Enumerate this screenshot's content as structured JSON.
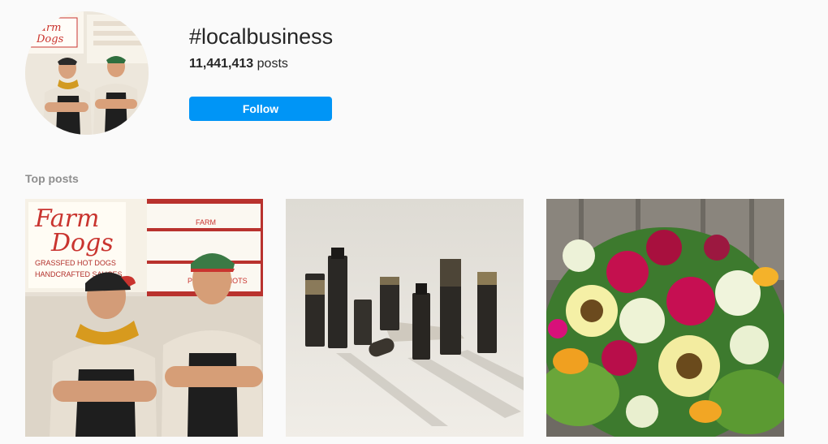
{
  "profile": {
    "avatar_icon": "avatar-photo",
    "hashtag": "#localbusiness",
    "post_count": "11,441,413",
    "post_count_suffix": " posts",
    "follow_label": "Follow"
  },
  "top_posts": {
    "label": "Top posts",
    "items": [
      {
        "sign_line1": "Farm",
        "sign_line2": "Dogs",
        "sign_text": "GRASSFED HOT DOGS",
        "sign_text2": "HANDCRAFTED SAUCES",
        "menu_header": "FARM",
        "menu_item": "PRETZEL KNOTS"
      },
      {
        "subject": "product-bottles-photo"
      },
      {
        "subject": "flower-bouquet-photo"
      }
    ]
  },
  "colors": {
    "accent": "#0095f6",
    "background": "#fafafa",
    "muted_text": "#8e8e8e"
  }
}
